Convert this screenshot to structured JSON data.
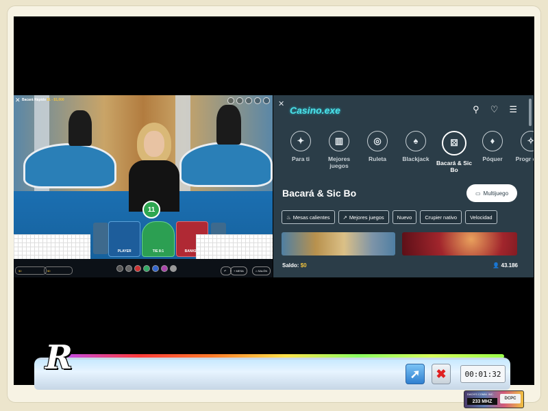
{
  "game": {
    "title": "Bacará Rápido",
    "limits": "$1 - $1,000",
    "timer": "11",
    "zones": {
      "player": "PLAYER",
      "tie": "TIE 8:1",
      "banker": "BANKER"
    },
    "balance_left": "$0",
    "bet_left": "$0",
    "buttons": {
      "mesa": "MESA",
      "salon": "SALÓN"
    }
  },
  "panel": {
    "logo": "Casino.exe",
    "categories": [
      {
        "label": "Para ti",
        "icon": "sparkle-icon"
      },
      {
        "label": "Mejores juegos",
        "icon": "podium-icon"
      },
      {
        "label": "Ruleta",
        "icon": "roulette-icon"
      },
      {
        "label": "Blackjack",
        "icon": "cards-icon"
      },
      {
        "label": "Bacará & Sic Bo",
        "icon": "dice-icon"
      },
      {
        "label": "Póquer",
        "icon": "poker-icon"
      },
      {
        "label": "Progr de ju",
        "icon": "progressive-icon"
      }
    ],
    "section_title": "Bacará & Sic Bo",
    "multi_button": "Multijuego",
    "filters": [
      "Mesas calientes",
      "Mejores juegos",
      "Nuevo",
      "Crupier nativo",
      "Velocidad"
    ],
    "balance_label": "Saldo:",
    "balance_value": "$0",
    "players_count": "43.186"
  },
  "taskbar": {
    "logo": "R",
    "clock": "00:01:32",
    "cpu_label": "DACH'S COMM. INC.",
    "cpu_mhz": "233 MHZ",
    "cpu_brand": "DCPC"
  }
}
